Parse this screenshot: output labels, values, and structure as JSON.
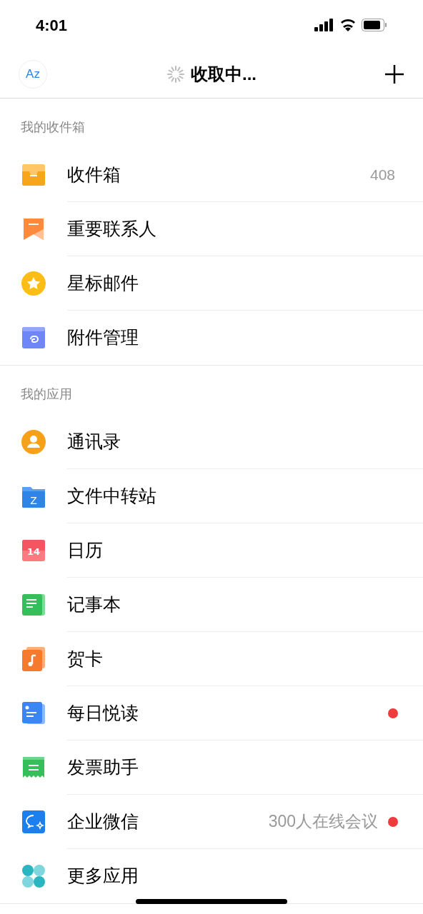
{
  "status_bar": {
    "time": "4:01"
  },
  "nav": {
    "avatar": "Az",
    "title": "收取中..."
  },
  "sections": [
    {
      "title": "我的收件箱",
      "items": [
        {
          "kind": "inbox",
          "label": "收件箱",
          "count": "408",
          "unread": false
        },
        {
          "kind": "bookmark",
          "label": "重要联系人",
          "unread": false
        },
        {
          "kind": "star",
          "label": "星标邮件",
          "unread": false
        },
        {
          "kind": "attachment",
          "label": "附件管理",
          "unread": false
        }
      ]
    },
    {
      "title": "我的应用",
      "items": [
        {
          "kind": "contact",
          "label": "通讯录",
          "unread": false
        },
        {
          "kind": "folder",
          "icon_text": "Z",
          "label": "文件中转站",
          "unread": false
        },
        {
          "kind": "calendar",
          "icon_text": "14",
          "label": "日历",
          "unread": false
        },
        {
          "kind": "note",
          "label": "记事本",
          "unread": false
        },
        {
          "kind": "card",
          "label": "贺卡",
          "unread": false
        },
        {
          "kind": "reading",
          "label": "每日悦读",
          "unread": true
        },
        {
          "kind": "invoice",
          "label": "发票助手",
          "unread": false
        },
        {
          "kind": "chat",
          "label": "企业微信",
          "note": "300人在线会议",
          "unread": true
        },
        {
          "kind": "apps",
          "label": "更多应用",
          "unread": false
        }
      ]
    }
  ]
}
